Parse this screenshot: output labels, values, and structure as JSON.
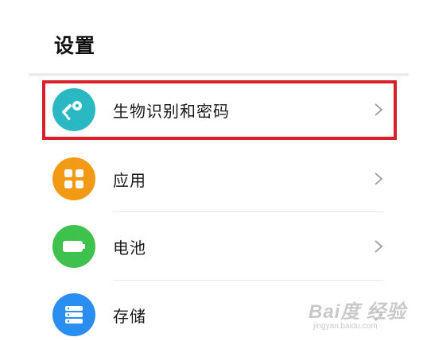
{
  "header": {
    "title": "设置"
  },
  "items": [
    {
      "label": "生物识别和密码",
      "icon": "key-icon",
      "color": "#2ab8c2",
      "highlighted": true
    },
    {
      "label": "应用",
      "icon": "apps-grid-icon",
      "color": "#f29a13"
    },
    {
      "label": "电池",
      "icon": "battery-icon",
      "color": "#3fc14e"
    },
    {
      "label": "存储",
      "icon": "storage-icon",
      "color": "#2a8ef0"
    }
  ],
  "highlight_color": "#d8202a",
  "watermark": {
    "main": "Bai度 经验",
    "sub": "jingyan.baidu.com"
  }
}
